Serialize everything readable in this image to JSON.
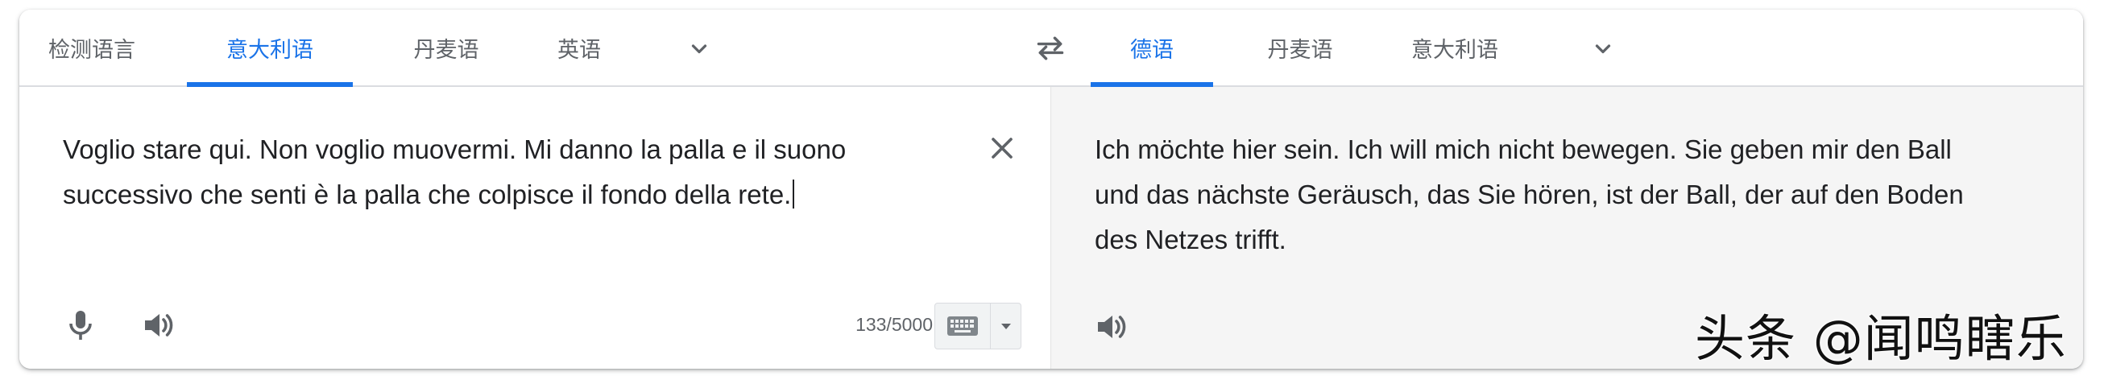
{
  "source_langs": {
    "detect": "检测语言",
    "italian": "意大利语",
    "danish": "丹麦语",
    "english": "英语"
  },
  "target_langs": {
    "german": "德语",
    "danish": "丹麦语",
    "italian": "意大利语"
  },
  "source": {
    "text": "Voglio stare qui. Non voglio muovermi. Mi danno la palla e il suono successivo che senti è la palla che colpisce il fondo della rete.",
    "char_count": "133/5000"
  },
  "target": {
    "text": "Ich möchte hier sein. Ich will mich nicht bewegen. Sie geben mir den Ball und das nächste Geräusch, das Sie hören, ist der Ball, der auf den Boden des Netzes trifft."
  },
  "watermark": "头条 @闻鸣瞎乐",
  "colors": {
    "accent": "#1a73e8",
    "icon": "#5f6368",
    "target_bg": "#f5f5f5"
  },
  "icons": [
    "chevron-down-icon",
    "swap-icon",
    "close-icon",
    "mic-icon",
    "speaker-icon",
    "keyboard-icon"
  ]
}
